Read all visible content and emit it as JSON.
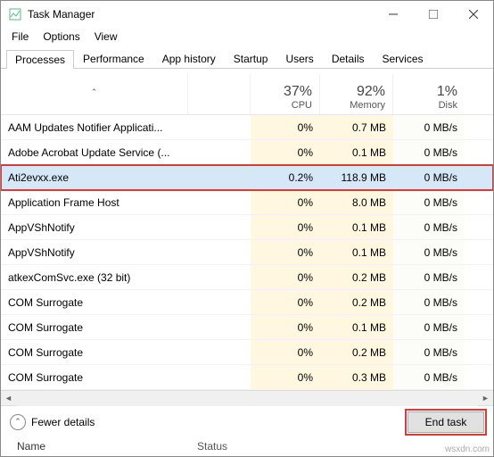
{
  "window": {
    "title": "Task Manager"
  },
  "menu": {
    "file": "File",
    "options": "Options",
    "view": "View"
  },
  "tabs": {
    "processes": "Processes",
    "performance": "Performance",
    "app_history": "App history",
    "startup": "Startup",
    "users": "Users",
    "details": "Details",
    "services": "Services"
  },
  "columns": {
    "name": "Name",
    "status": "Status",
    "cpu_pct": "37%",
    "cpu_label": "CPU",
    "mem_pct": "92%",
    "mem_label": "Memory",
    "disk_pct": "1%",
    "disk_label": "Disk"
  },
  "rows": [
    {
      "name": "AAM Updates Notifier Applicati...",
      "cpu": "0%",
      "mem": "0.7 MB",
      "disk": "0 MB/s",
      "selected": false,
      "highlight": false
    },
    {
      "name": "Adobe Acrobat Update Service (...",
      "cpu": "0%",
      "mem": "0.1 MB",
      "disk": "0 MB/s",
      "selected": false,
      "highlight": false
    },
    {
      "name": "Ati2evxx.exe",
      "cpu": "0.2%",
      "mem": "118.9 MB",
      "disk": "0 MB/s",
      "selected": true,
      "highlight": true
    },
    {
      "name": "Application Frame Host",
      "cpu": "0%",
      "mem": "8.0 MB",
      "disk": "0 MB/s",
      "selected": false,
      "highlight": false
    },
    {
      "name": "AppVShNotify",
      "cpu": "0%",
      "mem": "0.1 MB",
      "disk": "0 MB/s",
      "selected": false,
      "highlight": false
    },
    {
      "name": "AppVShNotify",
      "cpu": "0%",
      "mem": "0.1 MB",
      "disk": "0 MB/s",
      "selected": false,
      "highlight": false
    },
    {
      "name": "atkexComSvc.exe (32 bit)",
      "cpu": "0%",
      "mem": "0.2 MB",
      "disk": "0 MB/s",
      "selected": false,
      "highlight": false
    },
    {
      "name": "COM Surrogate",
      "cpu": "0%",
      "mem": "0.2 MB",
      "disk": "0 MB/s",
      "selected": false,
      "highlight": false
    },
    {
      "name": "COM Surrogate",
      "cpu": "0%",
      "mem": "0.1 MB",
      "disk": "0 MB/s",
      "selected": false,
      "highlight": false
    },
    {
      "name": "COM Surrogate",
      "cpu": "0%",
      "mem": "0.2 MB",
      "disk": "0 MB/s",
      "selected": false,
      "highlight": false
    },
    {
      "name": "COM Surrogate",
      "cpu": "0%",
      "mem": "0.3 MB",
      "disk": "0 MB/s",
      "selected": false,
      "highlight": false
    }
  ],
  "footer": {
    "fewer_details": "Fewer details",
    "end_task": "End task"
  },
  "watermark": "wsxdn.com"
}
